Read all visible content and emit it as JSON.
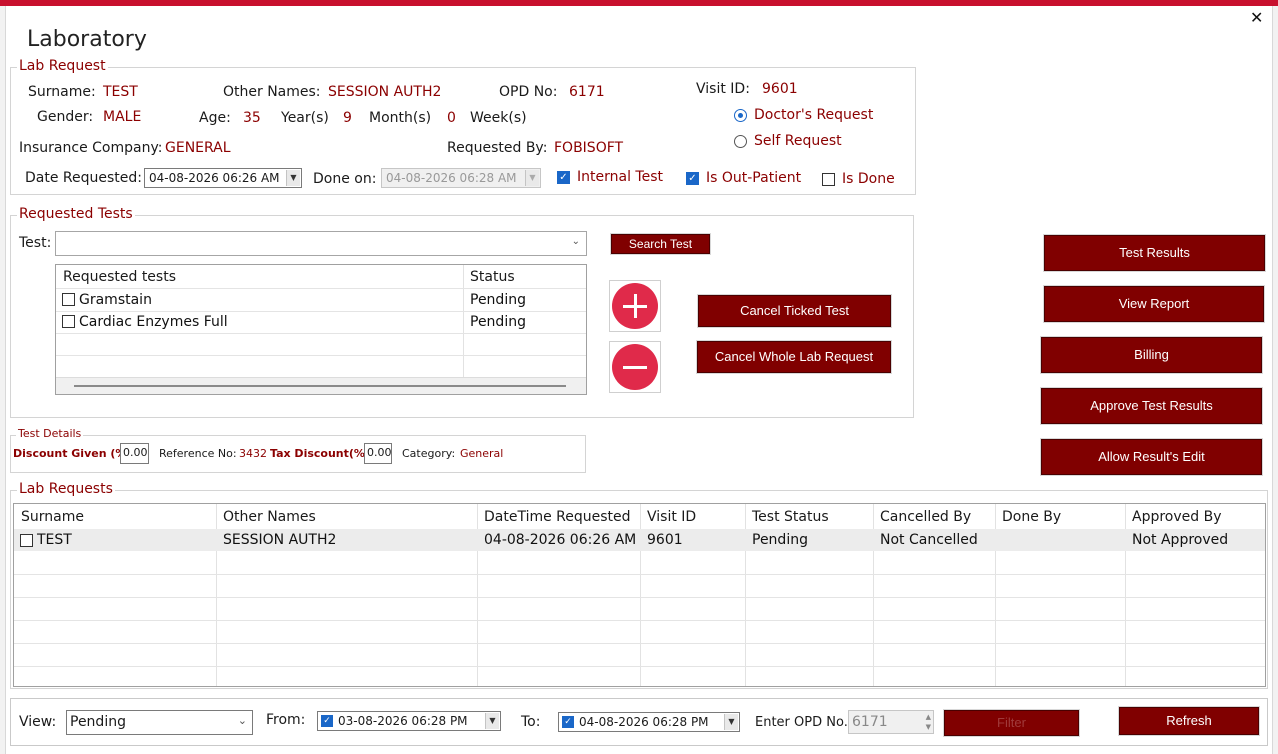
{
  "window": {
    "title": "Laboratory",
    "close_glyph": "✕"
  },
  "lab_request": {
    "legend": "Lab Request",
    "surname_label": "Surname:",
    "surname": "TEST",
    "other_names_label": "Other Names:",
    "other_names": "SESSION AUTH2",
    "opd_label": "OPD No:",
    "opd": "6171",
    "visit_label": "Visit ID:",
    "visit": "9601",
    "gender_label": "Gender:",
    "gender": "MALE",
    "age_label": "Age:",
    "age": "35",
    "years_label": "Year(s)",
    "months": "9",
    "months_label": "Month(s)",
    "weeks": "0",
    "weeks_label": "Week(s)",
    "doctors_request_label": "Doctor's Request",
    "self_request_label": "Self Request",
    "insurance_label": "Insurance Company:",
    "insurance": "GENERAL",
    "requested_by_label": "Requested By:",
    "requested_by": "FOBISOFT",
    "date_requested_label": "Date Requested:",
    "date_requested": "04-08-2026  06:26 AM",
    "done_on_label": "Done on:",
    "done_on": "04-08-2026  06:28 AM",
    "internal_test_label": "Internal Test",
    "out_patient_label": "Is Out-Patient",
    "is_done_label": "Is Done"
  },
  "requested_tests": {
    "legend": "Requested Tests",
    "test_label": "Test:",
    "test_value": "",
    "search_button": "Search Test",
    "columns": [
      "Requested tests",
      "Status"
    ],
    "rows": [
      {
        "name": "Gramstain",
        "status": "Pending"
      },
      {
        "name": "Cardiac Enzymes Full",
        "status": "Pending"
      }
    ],
    "cancel_ticked": "Cancel Ticked Test",
    "cancel_whole": "Cancel Whole Lab Request"
  },
  "test_details": {
    "legend": "Test Details",
    "discount_label": "Discount Given (%)",
    "discount": "0.00",
    "reference_label": "Reference No:",
    "reference": "3432",
    "tax_label": "Tax Discount(%)",
    "tax": "0.00",
    "category_label": "Category:",
    "category": "General"
  },
  "actions": {
    "test_results": "Test Results",
    "view_report": "View Report",
    "billing": "Billing",
    "approve": "Approve Test Results",
    "allow_edit": "Allow Result's Edit"
  },
  "lab_requests": {
    "legend": "Lab Requests",
    "columns": [
      "Surname",
      "Other Names",
      "DateTime Requested",
      "Visit ID",
      "Test Status",
      "Cancelled By",
      "Done By",
      "Approved By"
    ],
    "rows": [
      {
        "surname": "TEST",
        "other_names": "SESSION AUTH2",
        "datetime": "04-08-2026 06:26 AM",
        "visit": "9601",
        "status": "Pending",
        "cancelled_by": "Not Cancelled",
        "done_by": "",
        "approved_by": "Not Approved"
      }
    ]
  },
  "filter_bar": {
    "view_label": "View:",
    "view": "Pending",
    "from_label": "From:",
    "from": "03-08-2026  06:28 PM",
    "to_label": "To:",
    "to": "04-08-2026  06:28 PM",
    "opd_label": "Enter OPD No.",
    "opd": "6171",
    "filter_button": "Filter",
    "refresh_button": "Refresh"
  },
  "colors": {
    "brand": "#800000",
    "accent_text": "#8b0000",
    "check_blue": "#1a67c8",
    "add_red": "#e02a4a"
  }
}
